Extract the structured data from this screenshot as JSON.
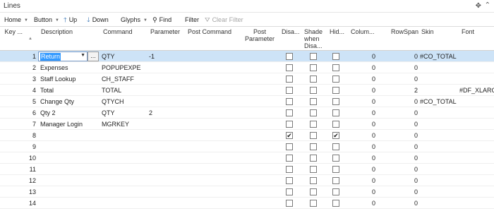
{
  "window": {
    "title": "Lines",
    "settings_icon": "gear-icon",
    "collapse_icon": "chevron-up-icon"
  },
  "toolbar": {
    "home": "Home",
    "button": "Button",
    "up": "Up",
    "down": "Down",
    "glyphs": "Glyphs",
    "find": "Find",
    "filter": "Filter",
    "clear_filter": "Clear Filter"
  },
  "columns": {
    "key": "Key ...",
    "description": "Description",
    "command": "Command",
    "parameter": "Parameter",
    "post_command": "Post Command",
    "post_parameter": "Post Parameter",
    "disabled": "Disa...",
    "shade": "Shade when Disa...",
    "hidden": "Hid...",
    "column": "Colum...",
    "rowspan": "RowSpan",
    "skin": "Skin",
    "font": "Font"
  },
  "selected_description": "Return",
  "lookup_label": "...",
  "rows": [
    {
      "key": "1",
      "description": "Return",
      "command": "QTY",
      "parameter": "-1",
      "disabled": false,
      "shade": false,
      "hidden": false,
      "column": "0",
      "rowspan": "0",
      "skin": "#CO_TOTAL",
      "font": ""
    },
    {
      "key": "2",
      "description": "Expenses",
      "command": "POPUPEXPE",
      "parameter": "",
      "disabled": false,
      "shade": false,
      "hidden": false,
      "column": "0",
      "rowspan": "0",
      "skin": "",
      "font": ""
    },
    {
      "key": "3",
      "description": "Staff Lookup",
      "command": "CH_STAFF",
      "parameter": "",
      "disabled": false,
      "shade": false,
      "hidden": false,
      "column": "0",
      "rowspan": "0",
      "skin": "",
      "font": ""
    },
    {
      "key": "4",
      "description": "Total",
      "command": "TOTAL",
      "parameter": "",
      "disabled": false,
      "shade": false,
      "hidden": false,
      "column": "0",
      "rowspan": "2",
      "skin": "",
      "font": "#DF_XLARGE"
    },
    {
      "key": "5",
      "description": "Change Qty",
      "command": "QTYCH",
      "parameter": "",
      "disabled": false,
      "shade": false,
      "hidden": false,
      "column": "0",
      "rowspan": "0",
      "skin": "#CO_TOTAL",
      "font": ""
    },
    {
      "key": "6",
      "description": "Qty 2",
      "command": "QTY",
      "parameter": "2",
      "disabled": false,
      "shade": false,
      "hidden": false,
      "column": "0",
      "rowspan": "0",
      "skin": "",
      "font": ""
    },
    {
      "key": "7",
      "description": "Manager Login",
      "command": "MGRKEY",
      "parameter": "",
      "disabled": false,
      "shade": false,
      "hidden": false,
      "column": "0",
      "rowspan": "0",
      "skin": "",
      "font": ""
    },
    {
      "key": "8",
      "description": "",
      "command": "",
      "parameter": "",
      "disabled": true,
      "shade": false,
      "hidden": true,
      "column": "0",
      "rowspan": "0",
      "skin": "",
      "font": ""
    },
    {
      "key": "9",
      "description": "",
      "command": "",
      "parameter": "",
      "disabled": false,
      "shade": false,
      "hidden": false,
      "column": "0",
      "rowspan": "0",
      "skin": "",
      "font": ""
    },
    {
      "key": "10",
      "description": "",
      "command": "",
      "parameter": "",
      "disabled": false,
      "shade": false,
      "hidden": false,
      "column": "0",
      "rowspan": "0",
      "skin": "",
      "font": ""
    },
    {
      "key": "11",
      "description": "",
      "command": "",
      "parameter": "",
      "disabled": false,
      "shade": false,
      "hidden": false,
      "column": "0",
      "rowspan": "0",
      "skin": "",
      "font": ""
    },
    {
      "key": "12",
      "description": "",
      "command": "",
      "parameter": "",
      "disabled": false,
      "shade": false,
      "hidden": false,
      "column": "0",
      "rowspan": "0",
      "skin": "",
      "font": ""
    },
    {
      "key": "13",
      "description": "",
      "command": "",
      "parameter": "",
      "disabled": false,
      "shade": false,
      "hidden": false,
      "column": "0",
      "rowspan": "0",
      "skin": "",
      "font": ""
    },
    {
      "key": "14",
      "description": "",
      "command": "",
      "parameter": "",
      "disabled": false,
      "shade": false,
      "hidden": false,
      "column": "0",
      "rowspan": "0",
      "skin": "",
      "font": ""
    }
  ],
  "colors": {
    "selected_row": "#cde3f7",
    "arrow_blue": "#2b6cb0",
    "text_selection": "#3399ff"
  }
}
